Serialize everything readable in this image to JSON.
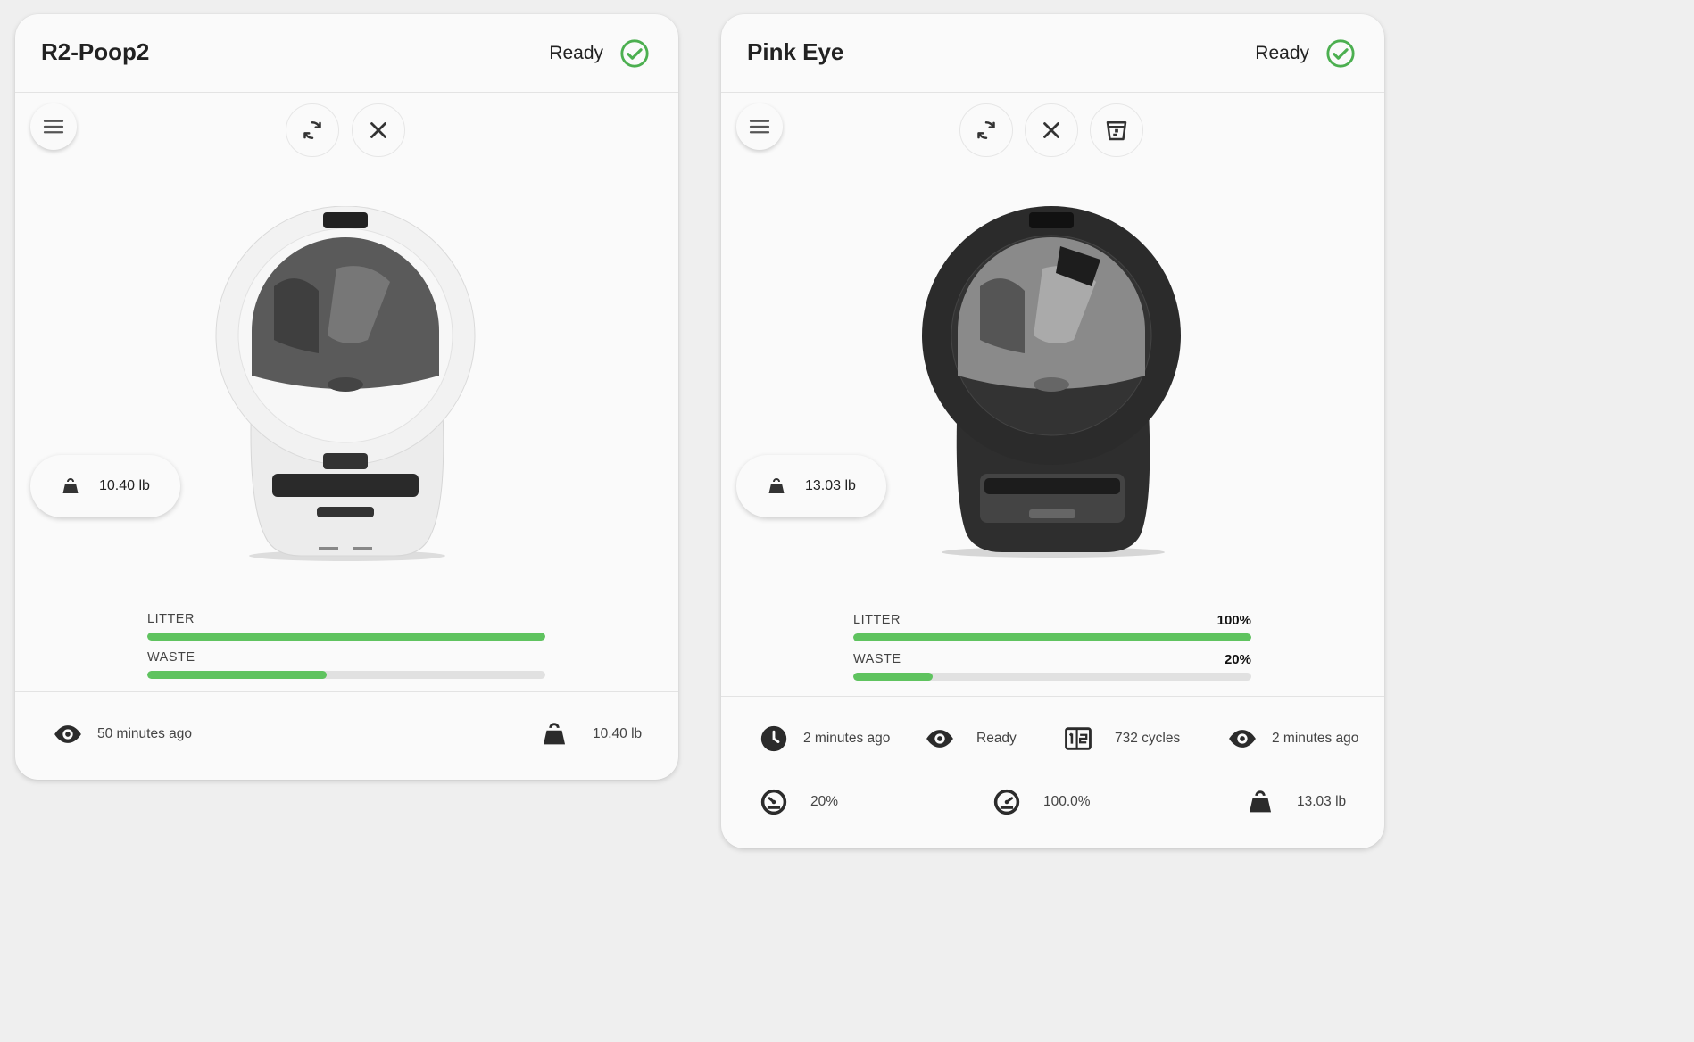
{
  "cards": [
    {
      "title": "R2-Poop2",
      "status": "Ready",
      "weight_pill": "10.40 lb",
      "bars": [
        {
          "label": "LITTER",
          "value": "",
          "level": 1.0
        },
        {
          "label": "WASTE",
          "value": "",
          "level": 0.45
        }
      ],
      "footer": {
        "last_seen": "50 minutes ago",
        "weight": "10.40 lb"
      },
      "robot_color": "white"
    },
    {
      "title": "Pink Eye",
      "status": "Ready",
      "weight_pill": "13.03 lb",
      "bars": [
        {
          "label": "LITTER",
          "value": "100%",
          "level": 1.0
        },
        {
          "label": "WASTE",
          "value": "20%",
          "level": 0.2
        }
      ],
      "footer": {
        "last_cycle": "2 minutes ago",
        "state": "Ready",
        "cycles": "732 cycles",
        "last_seen": "2 minutes ago",
        "waste_gauge": "20%",
        "litter_gauge": "100.0%",
        "weight": "13.03 lb"
      },
      "robot_color": "black"
    }
  ],
  "colors": {
    "accent_green": "#5fc35f",
    "status_green": "#4caf50",
    "icon_dark": "#2b2b2b"
  },
  "icons": {
    "status": "check-circle-icon",
    "menu": "menu-icon",
    "cycle": "refresh-icon",
    "stop": "close-icon",
    "empty": "trash-icon",
    "seen": "eye-icon",
    "weight": "weight-icon",
    "clock": "clock-icon",
    "counter": "counter-icon",
    "gauge": "gauge-icon"
  }
}
